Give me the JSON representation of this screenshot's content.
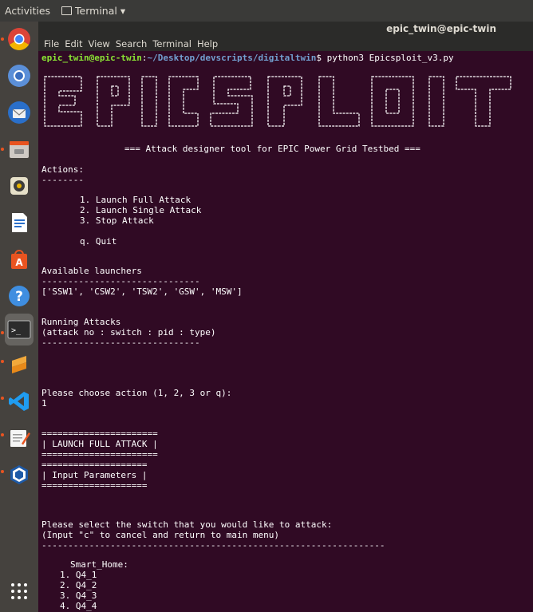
{
  "topbar": {
    "activities": "Activities",
    "app_name": "Terminal ▾"
  },
  "window": {
    "title": "epic_twin@epic-twin"
  },
  "menu": [
    "File",
    "Edit",
    "View",
    "Search",
    "Terminal",
    "Help"
  ],
  "dock_icons": [
    "chrome-icon",
    "chromium-icon",
    "thunderbird-icon",
    "files-icon",
    "rhythmbox-icon",
    "writer-icon",
    "software-center-icon",
    "help-icon",
    "terminal-icon",
    "sublime-icon",
    "vscode-icon",
    "text-editor-icon",
    "virtualbox-icon",
    "show-apps-icon"
  ],
  "prompt": {
    "user": "epic_twin@epic-twin",
    "sep": ":",
    "path": "~/Desktop/devscripts/digitaltwin",
    "symbol": "$",
    "command": " python3 Epicsploit_v3.py"
  },
  "terminal": {
    "subtitle": "=== Attack designer tool for EPIC Power Grid Testbed ===",
    "actions_header": "Actions:",
    "actions_rule": "--------",
    "action1": "1. Launch Full Attack",
    "action2": "2. Launch Single Attack",
    "action3": "3. Stop Attack",
    "action_quit": "q. Quit",
    "launchers_header": "Available launchers",
    "launchers_rule": "------------------------------",
    "launchers_list": "['SSW1', 'CSW2', 'TSW2', 'GSW', 'MSW']",
    "running_header": "Running Attacks",
    "running_cols": "(attack no : switch : pid : type)",
    "running_rule": "------------------------------",
    "choose_prompt": "Please choose action (1, 2, 3 or q):",
    "choose_input": "1",
    "box1_top": "======================",
    "box1_text": "| LAUNCH FULL ATTACK |",
    "box1_bottom": "======================",
    "box2_top": "====================",
    "box2_text": "| Input Parameters |",
    "box2_bottom": "====================",
    "switch_prompt": "Please select the switch that you would like to attack:",
    "cancel_hint": "(Input \"c\" to cancel and return to main menu)",
    "switch_rule": "-----------------------------------------------------------------",
    "group_label": "Smart_Home:",
    "switches": [
      "1. Q4_1",
      "2. Q4_2",
      "3. Q4_3",
      "4. Q4_4"
    ]
  },
  "colors": {
    "terminal_bg": "#300a24",
    "prompt_user": "#8ae234",
    "prompt_path": "#729fcf",
    "accent": "#e95420"
  }
}
